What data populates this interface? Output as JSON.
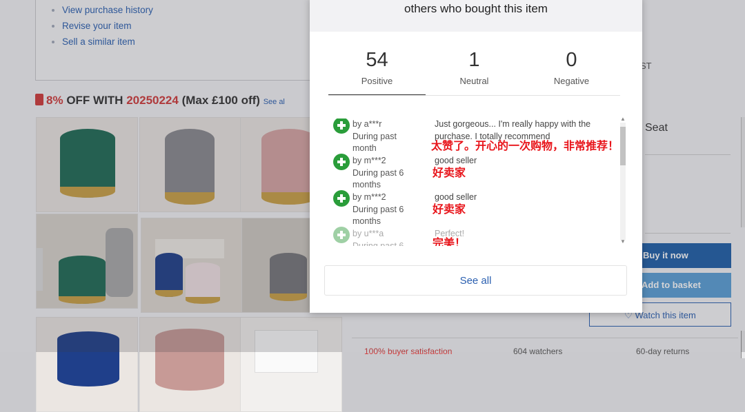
{
  "actions": {
    "items": [
      "View purchase history",
      "Revise your item",
      "Sell a similar item"
    ]
  },
  "coupon": {
    "percent": "8%",
    "off_with": "OFF WITH",
    "code": "20250224",
    "max": "(Max £100 off)",
    "see_all": "See al"
  },
  "right": {
    "st_text": "ST",
    "seat_text": "Seat",
    "buy_now": "Buy it now",
    "add_to_basket": "Add to basket",
    "watch": "♡ Watch this item"
  },
  "stats": {
    "satisfaction": "100% buyer satisfaction",
    "watchers": "604 watchers",
    "returns": "60-day returns"
  },
  "modal": {
    "title": "others who bought this item",
    "tabs": [
      {
        "count": "54",
        "label": "Positive"
      },
      {
        "count": "1",
        "label": "Neutral"
      },
      {
        "count": "0",
        "label": "Negative"
      }
    ],
    "feedback": [
      {
        "user": "by a***r",
        "period": "During past month",
        "comment": "Just gorgeous... I'm really happy with the purchase. I totally recommend",
        "translation": "太赞了。开心的一次购物，非常推荐！"
      },
      {
        "user": "by m***2",
        "period": "During past 6 months",
        "comment": "good seller",
        "translation": "好卖家"
      },
      {
        "user": "by m***2",
        "period": "During past 6 months",
        "comment": "good seller",
        "translation": "好卖家"
      },
      {
        "user": "by u***a",
        "period": "During past 6",
        "comment": "Perfect!",
        "translation": "完美！"
      }
    ],
    "see_all": "See all"
  },
  "colors": {
    "positive_icon": "#2a9d3a",
    "translation_red": "#e8151b",
    "link_blue": "#2a5fb0",
    "buy_button": "#1f5fa8"
  }
}
